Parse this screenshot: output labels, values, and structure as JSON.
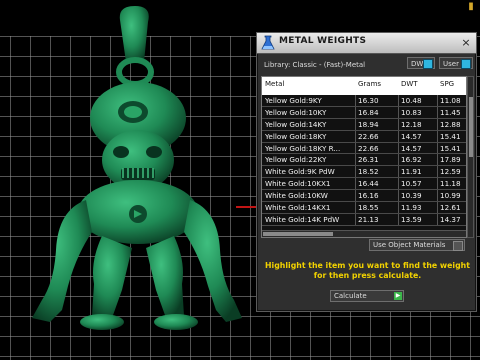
{
  "dialog": {
    "title": "METAL WEIGHTS",
    "close_glyph": "×",
    "library_label": "Library: Classic - (Fast)-Metal",
    "unit_dwt": "DWT",
    "unit_user": "User",
    "use_object_materials": "Use Object Materials",
    "hint": "Highlight the item you want to find the weight for then press calculate.",
    "calculate_label": "Calculate"
  },
  "table": {
    "headers": [
      "Metal",
      "Grams",
      "DWT",
      "SPG"
    ],
    "rows": [
      [
        "Yellow Gold:9KY",
        "16.30",
        "10.48",
        "11.08"
      ],
      [
        "Yellow Gold:10KY",
        "16.84",
        "10.83",
        "11.45"
      ],
      [
        "Yellow Gold:14KY",
        "18.94",
        "12.18",
        "12.88"
      ],
      [
        "Yellow Gold:18KY",
        "22.66",
        "14.57",
        "15.41"
      ],
      [
        "Yellow Gold:18KY R...",
        "22.66",
        "14.57",
        "15.41"
      ],
      [
        "Yellow Gold:22KY",
        "26.31",
        "16.92",
        "17.89"
      ],
      [
        "White Gold:9K PdW",
        "18.52",
        "11.91",
        "12.59"
      ],
      [
        "White Gold:10KX1",
        "16.44",
        "10.57",
        "11.18"
      ],
      [
        "White Gold:10KW",
        "16.16",
        "10.39",
        "10.99"
      ],
      [
        "White Gold:14KX1",
        "18.55",
        "11.93",
        "12.61"
      ],
      [
        "White Gold:14K PdW",
        "21.13",
        "13.59",
        "14.37"
      ]
    ]
  },
  "icons": {
    "dialog": "beaker-icon",
    "corner": "coin-icon"
  },
  "colors": {
    "figure": "#1f8a55",
    "hint": "#f2d200",
    "grid_axis": "#c21515",
    "toggle_lamp": "#2fb6e0"
  }
}
